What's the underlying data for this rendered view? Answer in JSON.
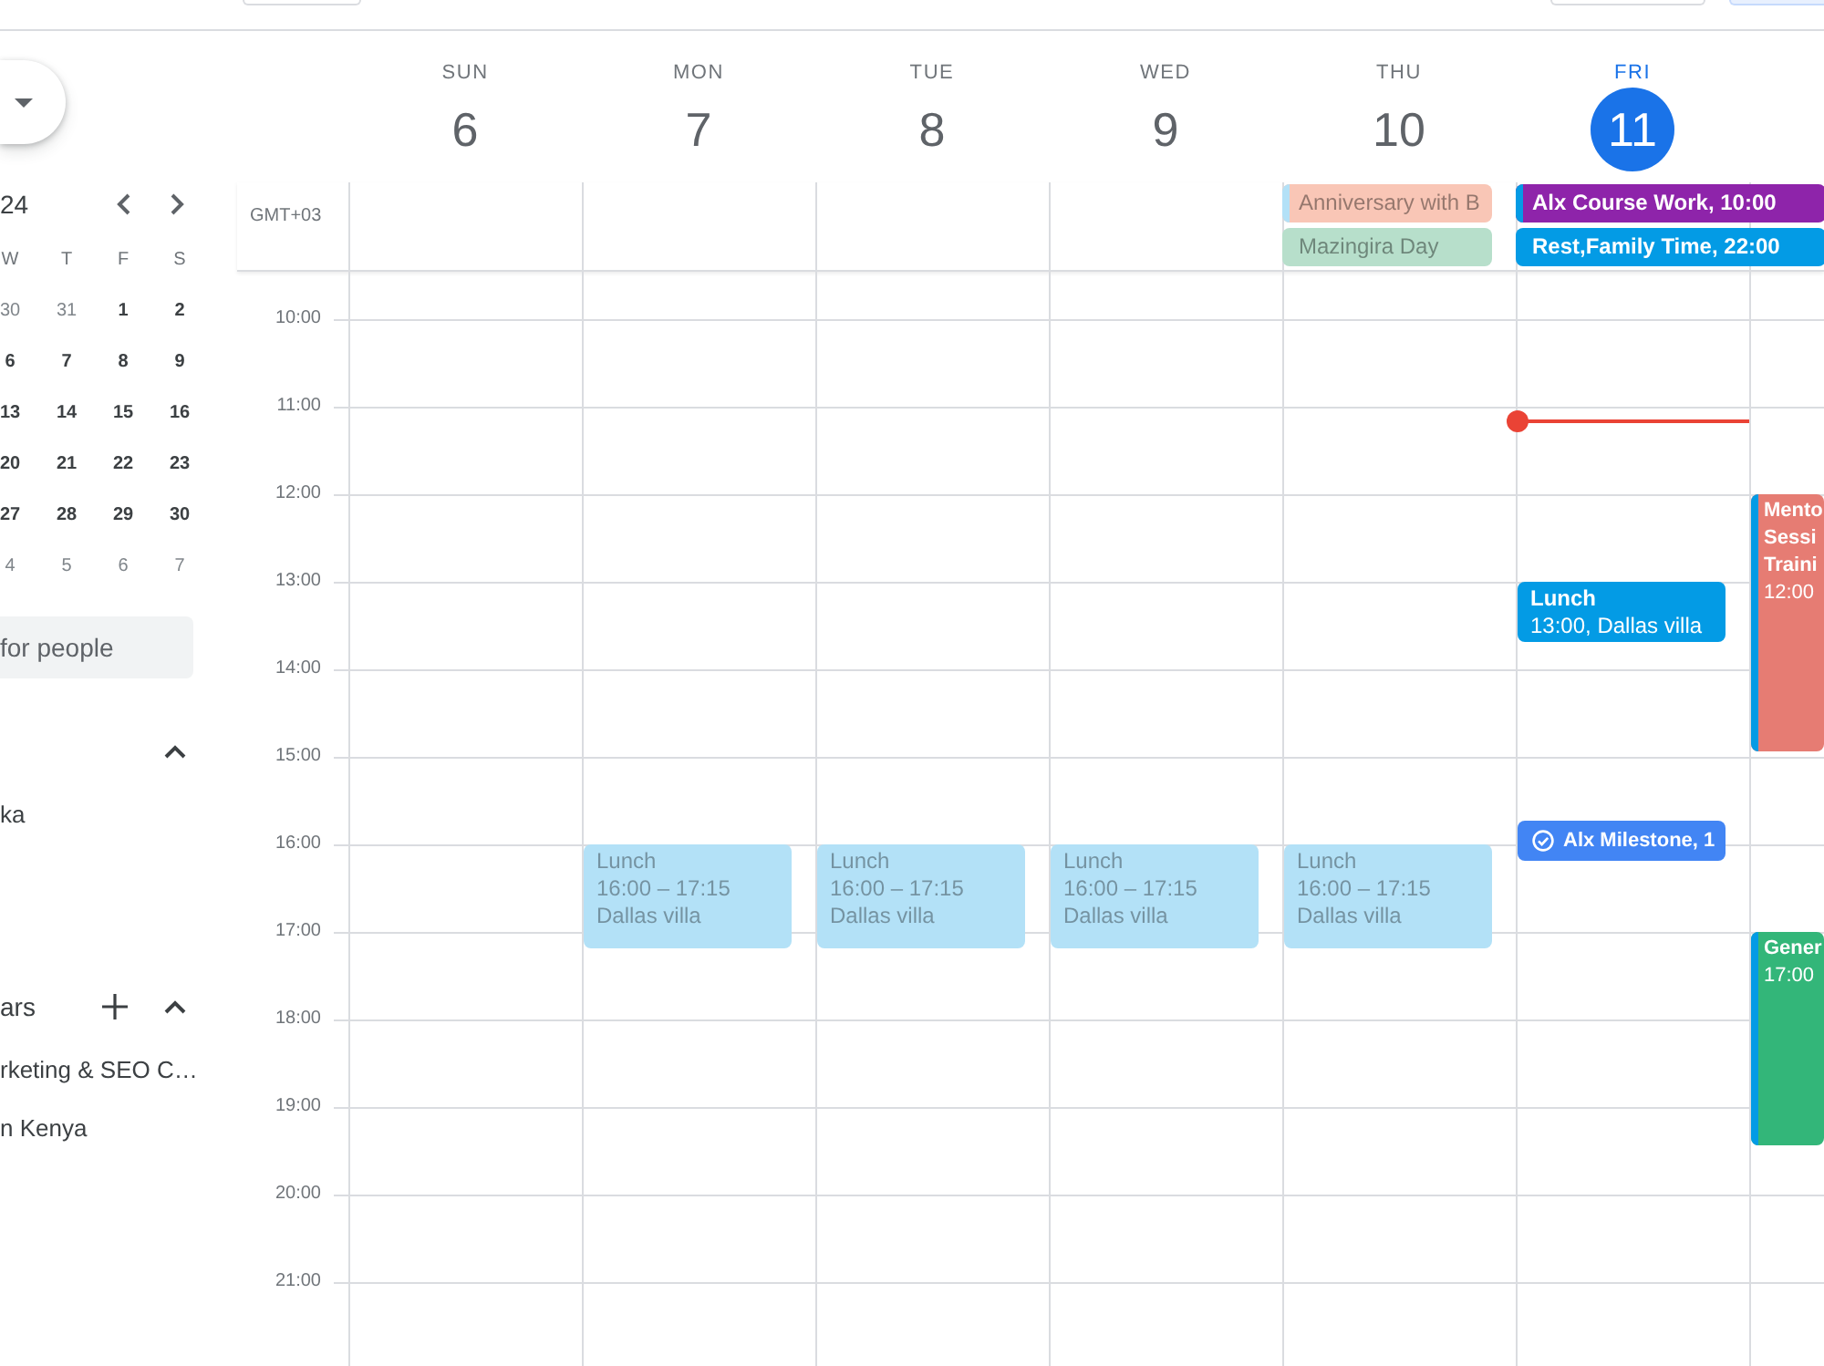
{
  "sidebar": {
    "mini_calendar": {
      "title": "24",
      "weekdays": [
        "W",
        "T",
        "F",
        "S"
      ],
      "weeks": [
        [
          {
            "day": "30",
            "in_month": false
          },
          {
            "day": "31",
            "in_month": false
          },
          {
            "day": "1",
            "in_month": true
          },
          {
            "day": "2",
            "in_month": true
          }
        ],
        [
          {
            "day": "6",
            "in_month": true
          },
          {
            "day": "7",
            "in_month": true
          },
          {
            "day": "8",
            "in_month": true
          },
          {
            "day": "9",
            "in_month": true
          }
        ],
        [
          {
            "day": "13",
            "in_month": true
          },
          {
            "day": "14",
            "in_month": true
          },
          {
            "day": "15",
            "in_month": true
          },
          {
            "day": "16",
            "in_month": true
          }
        ],
        [
          {
            "day": "20",
            "in_month": true
          },
          {
            "day": "21",
            "in_month": true
          },
          {
            "day": "22",
            "in_month": true
          },
          {
            "day": "23",
            "in_month": true
          }
        ],
        [
          {
            "day": "27",
            "in_month": true
          },
          {
            "day": "28",
            "in_month": true
          },
          {
            "day": "29",
            "in_month": true
          },
          {
            "day": "30",
            "in_month": true
          }
        ],
        [
          {
            "day": "4",
            "in_month": false
          },
          {
            "day": "5",
            "in_month": false
          },
          {
            "day": "6",
            "in_month": false
          },
          {
            "day": "7",
            "in_month": false
          }
        ]
      ]
    },
    "people_search": {
      "placeholder": "for people"
    },
    "my_calendars": {
      "expanded": true,
      "items": [
        {
          "label": "ka"
        }
      ]
    },
    "other_calendars": {
      "title": "ars",
      "expanded": true,
      "items": [
        {
          "label": "rketing & SEO C…"
        },
        {
          "label": "n Kenya"
        }
      ]
    }
  },
  "calendar": {
    "timezone": "GMT+03",
    "hours": [
      "10:00",
      "11:00",
      "12:00",
      "13:00",
      "14:00",
      "15:00",
      "16:00",
      "17:00",
      "18:00",
      "19:00",
      "20:00",
      "21:00"
    ],
    "days": [
      {
        "weekday": "SUN",
        "date": "6",
        "today": false
      },
      {
        "weekday": "MON",
        "date": "7",
        "today": false,
        "events": [
          {
            "kind": "timed",
            "title_lines": [
              "Lunch"
            ],
            "details": [
              "16:00 – 17:15",
              "Dallas villa"
            ],
            "color": "#b3e1f7",
            "past": true
          }
        ]
      },
      {
        "weekday": "TUE",
        "date": "8",
        "today": false,
        "events": [
          {
            "kind": "timed",
            "title_lines": [
              "Lunch"
            ],
            "details": [
              "16:00 – 17:15",
              "Dallas villa"
            ],
            "color": "#b3e1f7",
            "past": true
          }
        ]
      },
      {
        "weekday": "WED",
        "date": "9",
        "today": false,
        "events": [
          {
            "kind": "timed",
            "title_lines": [
              "Lunch"
            ],
            "details": [
              "16:00 – 17:15",
              "Dallas villa"
            ],
            "color": "#b3e1f7",
            "past": true
          }
        ]
      },
      {
        "weekday": "THU",
        "date": "10",
        "today": false,
        "all_day": [
          {
            "title": "Anniversary with B",
            "color": "#f9c6b6",
            "strip": {
              "color": "#b3e1f7"
            },
            "past": true
          },
          {
            "title": "Mazingira Day",
            "color": "#b7dfcb",
            "past": true
          }
        ],
        "events": [
          {
            "kind": "timed",
            "title_lines": [
              "Lunch"
            ],
            "details": [
              "16:00 – 17:15",
              "Dallas villa"
            ],
            "color": "#b3e1f7",
            "past": true
          }
        ]
      },
      {
        "weekday": "FRI",
        "date": "11",
        "today": true,
        "all_day": [
          {
            "title": "Alx Course Work, 10:00",
            "color": "#8e24aa",
            "strip": {
              "color": "#039be5"
            },
            "past": false
          },
          {
            "title": "Rest,Family Time, 22:00",
            "color": "#039be5",
            "past": false
          }
        ],
        "events": [
          {
            "kind": "timed",
            "title_lines": [
              "Lunch"
            ],
            "details": [
              "13:00, Dallas villa"
            ],
            "color": "#039be5",
            "past": false
          },
          {
            "kind": "task",
            "title_lines": [
              "Alx Milestone, 1"
            ],
            "color": "#4285f4",
            "past": false
          }
        ]
      },
      {
        "events": [
          {
            "kind": "timed",
            "title_lines": [
              "Mento",
              "Sessi",
              "Traini"
            ],
            "details": [
              "12:00"
            ],
            "color": "#e67c73",
            "strip": {
              "color": "#039be5"
            },
            "past": false
          },
          {
            "kind": "timed",
            "title_lines": [
              "Gener"
            ],
            "details": [
              "17:00"
            ],
            "color": "#33b679",
            "strip": {
              "color": "#039be5"
            },
            "past": false
          }
        ]
      }
    ]
  }
}
